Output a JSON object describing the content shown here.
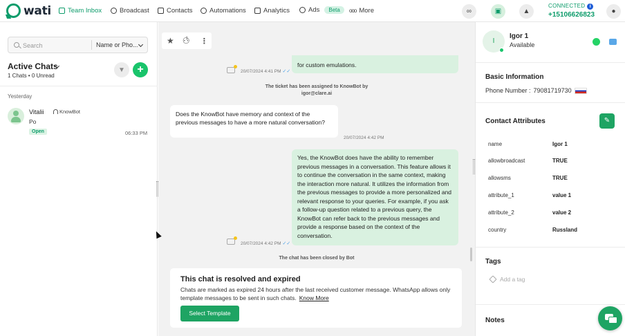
{
  "brand": {
    "name": "wati",
    "accent": "#0d9c6b"
  },
  "nav": {
    "items": [
      {
        "label": "Team Inbox",
        "icon": "inbox-icon",
        "active": true
      },
      {
        "label": "Broadcast",
        "icon": "broadcast-icon"
      },
      {
        "label": "Contacts",
        "icon": "contacts-icon"
      },
      {
        "label": "Automations",
        "icon": "automations-icon"
      },
      {
        "label": "Analytics",
        "icon": "analytics-icon"
      },
      {
        "label": "Ads",
        "icon": "ads-icon",
        "badge": "Beta"
      },
      {
        "label": "More",
        "icon": "more-icon"
      }
    ],
    "status": "CONNECTED",
    "phone": "+15106626823"
  },
  "left": {
    "search_placeholder": "Search",
    "search_filter": "Name or Pho...",
    "title": "Active Chats",
    "counts": "1 Chats • 0 Unread",
    "group_label": "Yesterday",
    "chats": [
      {
        "name": "Vitalii",
        "agent": "KnowBot",
        "preview": "Po",
        "status": "Open",
        "time": "06:33 PM"
      }
    ]
  },
  "conversation": {
    "msg_partial": "for custom emulations.",
    "msg_partial_time": "20/07/2024 4:41 PM",
    "sys_assigned_line1": "The ticket has been assigned to KnowBot by",
    "sys_assigned_line2": "igor@clare.ai",
    "msg_in_text": "Does the KnowBot have memory and context of the previous messages to have a more natural conversation?",
    "msg_in_time": "20/07/2024 4:42 PM",
    "msg_out_text": "Yes, the KnowBot does have the ability to remember previous messages in a conversation. This feature allows it to continue the conversation in the same context, making the interaction more natural. It utilizes the information from the previous messages to provide a more personalized and relevant response to your queries. For example, if you ask a follow-up question related to a previous query, the KnowBot can refer back to the previous messages and provide a response based on the context of the conversation.",
    "msg_out_time": "20/07/2024 4:42 PM",
    "sys_closed": "The chat has been closed by Bot",
    "resolved_title": "This chat is resolved and expired",
    "resolved_text": "Chats are marked as expired 24 hours after the last received customer message. WhatsApp allows only template messages to be sent in such chats.",
    "know_more": "Know More",
    "select_template": "Select Template"
  },
  "contact": {
    "initial": "I",
    "name": "Igor 1",
    "status": "Available",
    "basic_info_title": "Basic Information",
    "phone_label": "Phone Number :",
    "phone_value": "79081719730",
    "attributes_title": "Contact Attributes",
    "attributes": [
      {
        "key": "name",
        "value": "Igor 1"
      },
      {
        "key": "allowbroadcast",
        "value": "TRUE"
      },
      {
        "key": "allowsms",
        "value": "TRUE"
      },
      {
        "key": "attribute_1",
        "value": "value 1"
      },
      {
        "key": "attribute_2",
        "value": "value 2"
      },
      {
        "key": "country",
        "value": "Russland"
      }
    ],
    "tags_title": "Tags",
    "tag_placeholder": "Add a tag",
    "notes_title": "Notes"
  }
}
